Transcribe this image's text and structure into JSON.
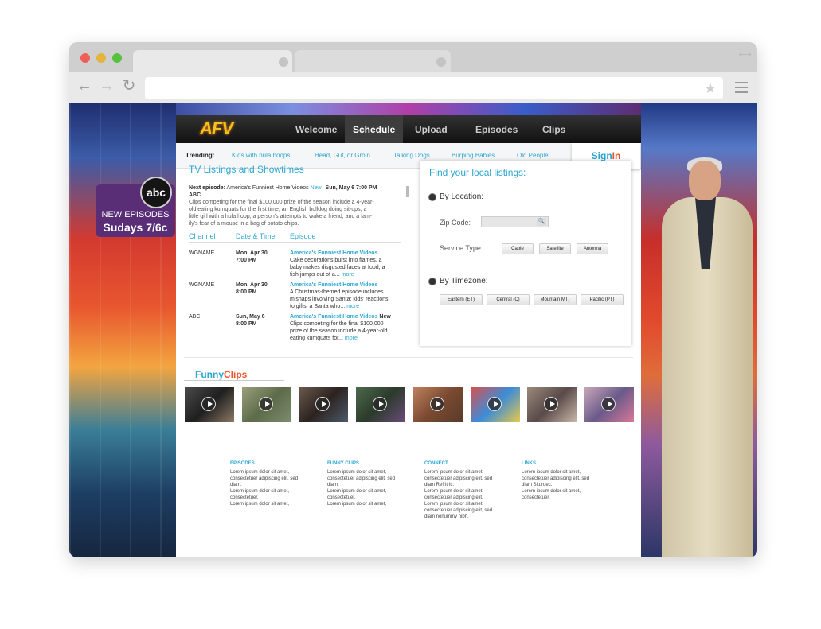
{
  "browser": {
    "colors": {
      "close": "#ee5f57",
      "minimize": "#e3b43e",
      "maximize": "#56c13e"
    },
    "icons": {
      "back": "back-arrow-icon",
      "forward": "forward-arrow-icon",
      "refresh": "refresh-icon",
      "bookmark": "star-icon",
      "menu": "hamburger-menu-icon",
      "fullscreen": "fullscreen-icon"
    }
  },
  "site": {
    "logo": "AFV",
    "nav": [
      "Welcome",
      "Schedule",
      "Upload",
      "Episodes",
      "Clips"
    ],
    "active_nav": "Schedule",
    "trending_label": "Trending:",
    "trending": [
      "Kids with hula hoops",
      "Head, Gut, or Groin",
      "Talking Dogs",
      "Burping Babies",
      "Old People"
    ],
    "signin": {
      "part1": "Sign",
      "part2": "In"
    },
    "promo": {
      "network": "abc",
      "line1": "NEW EPISODES",
      "line2": "Sudays 7/6c"
    }
  },
  "listings": {
    "title": "TV Listings and Showtimes",
    "next_label": "Next episode:",
    "next_show": "America's Funniest Home Videos",
    "next_new": "New",
    "next_time": "Sun, May 6 7:00 PM",
    "next_channel": "ABC",
    "next_desc_lines": [
      "Clips competing for the final $100,000 prize of the season include a 4-year-",
      "old eating kumquats for the first time; an English bulldog doing sit-ups; a",
      "little girl with a hula hoop; a person's attempts to wake a friend; and a fam-",
      "ily's fear of a mouse in a bag of potato chips."
    ],
    "headers": [
      "Channel",
      "Date & Time",
      "Episode"
    ],
    "rows": [
      {
        "channel": "WGNAME",
        "date": "Mon, Apr 30",
        "time": "7:00 PM",
        "title": "America's Funniest Home Videos",
        "new": "",
        "desc": [
          "Cake decorations burst into flames, a",
          "baby makes disgusted faces at food; a",
          "fish jumps out of a..."
        ],
        "more": "more"
      },
      {
        "channel": "WGNAME",
        "date": "Mon, Apr 30",
        "time": "8:00 PM",
        "title": "America's Funniest Home Videos",
        "new": "",
        "desc": [
          "A Christmas-themed episode includes",
          "mishaps involving Santa; kids' reactions",
          "to gifts; a Santa who..."
        ],
        "more": "more"
      },
      {
        "channel": "ABC",
        "date": "Sun, May 6",
        "time": "8:00 PM",
        "title": "America's Funniest Home Videos",
        "new": "New",
        "desc": [
          "Clips competing for the final $100,000",
          "prize of the season include a 4-year-old",
          "eating kumquats for..."
        ],
        "more": "more"
      }
    ]
  },
  "local": {
    "title": "Find your local listings:",
    "by_location": "By Location:",
    "zip_label": "Zip Code:",
    "service_label": "Service Type:",
    "services": [
      "Cable",
      "Satellite",
      "Antenna"
    ],
    "by_timezone": "By Timezone:",
    "timezones": [
      "Eastern (ET)",
      "Central (C)",
      "Mountain MT)",
      "Pacific (PT)"
    ]
  },
  "funny": {
    "part1": "Funny",
    "part2": "Clips",
    "thumb_colors": [
      "#3a3a3a",
      "#6f7a5a",
      "#4a3b34",
      "#3b4f3e",
      "#8a5a3b",
      "#b8444e",
      "#6b5a52",
      "#7b6a8a"
    ]
  },
  "footer": [
    {
      "title": "EPISODES",
      "lines": [
        "Lorem ipsum dolor sit amet,",
        "consectetuer adipiscing elit, sed",
        "diam.",
        "Lorem ipsum dolor sit amet,",
        "consectetuer.",
        "Lorem ipsum dolor sit amet,"
      ]
    },
    {
      "title": "FUNNY CLIPS",
      "lines": [
        "Lorem ipsum dolor sit amet,",
        "consectetuer adipiscing elit, sed",
        "diam.",
        "Lorem ipsum dolor sit amet,",
        "consectetuer.",
        "Lorem ipsum dolor sit amet,"
      ]
    },
    {
      "title": "CONNECT",
      "lines": [
        "Lorem ipsum dolor sit amet,",
        "consectetuer adipiscing elit, sed",
        "diam Refritric.",
        "Lorem ipsum dolor sit amet,",
        "consectetuer adipiscing elit.",
        "Lorem ipsum dolor sit amet,",
        "consectetuer adipiscing elit, sed",
        "diam nonummy nibh."
      ]
    },
    {
      "title": "LINKS",
      "lines": [
        "Lorem ipsum dolor sit amet,",
        "consectetuer adipiscing elit, sed",
        "diam Siturdec.",
        "Lorem ipsum dolor sit amet,",
        "consectetuer."
      ]
    }
  ]
}
